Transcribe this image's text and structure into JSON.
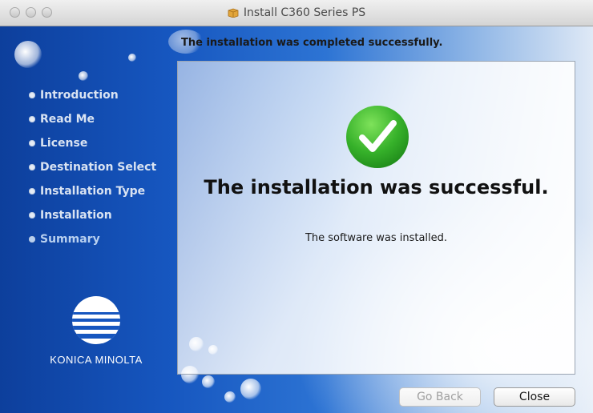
{
  "window": {
    "title": "Install C360 Series PS",
    "title_icon": "package-icon"
  },
  "header": {
    "text": "The installation was completed successfully."
  },
  "sidebar": {
    "steps": [
      {
        "label": "Introduction"
      },
      {
        "label": "Read Me"
      },
      {
        "label": "License"
      },
      {
        "label": "Destination Select"
      },
      {
        "label": "Installation Type"
      },
      {
        "label": "Installation"
      },
      {
        "label": "Summary"
      }
    ],
    "current_step": "Summary",
    "logo_text": "KONICA MINOLTA"
  },
  "main": {
    "status_icon": "checkmark-icon",
    "message": "The installation was successful.",
    "detail": "The software was installed."
  },
  "buttons": {
    "go_back": "Go Back",
    "close": "Close"
  },
  "colors": {
    "accent_green": "#3fbf2f",
    "sidebar_blue": "#1656bf"
  }
}
